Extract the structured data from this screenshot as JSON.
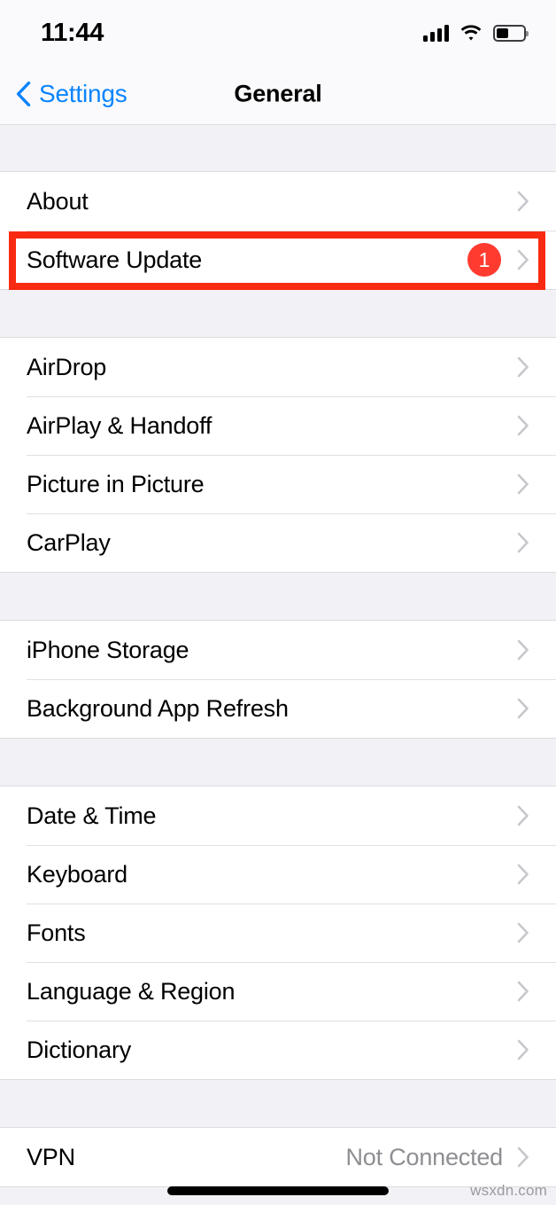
{
  "status_bar": {
    "time": "11:44",
    "cellular_icon": "cellular-signal-icon",
    "wifi_icon": "wifi-icon",
    "battery_icon": "battery-icon",
    "battery_level_percent": 40
  },
  "nav_bar": {
    "back_label": "Settings",
    "back_icon": "chevron-left-icon",
    "title": "General"
  },
  "colors": {
    "accent_blue": "#0A84FF",
    "badge_red": "#FF3B30",
    "highlight_red": "#F92A12",
    "separator": "#E0E0E3",
    "group_background": "#F2F2F6",
    "value_gray": "#8E8E93",
    "chevron_gray": "#C7C7CC"
  },
  "groups": [
    {
      "rows": [
        {
          "label": "About",
          "value": "",
          "badge": "",
          "chevron": "chevron-right-icon"
        },
        {
          "label": "Software Update",
          "value": "",
          "badge": "1",
          "chevron": "chevron-right-icon"
        }
      ]
    },
    {
      "rows": [
        {
          "label": "AirDrop",
          "value": "",
          "badge": "",
          "chevron": "chevron-right-icon"
        },
        {
          "label": "AirPlay & Handoff",
          "value": "",
          "badge": "",
          "chevron": "chevron-right-icon"
        },
        {
          "label": "Picture in Picture",
          "value": "",
          "badge": "",
          "chevron": "chevron-right-icon"
        },
        {
          "label": "CarPlay",
          "value": "",
          "badge": "",
          "chevron": "chevron-right-icon"
        }
      ]
    },
    {
      "rows": [
        {
          "label": "iPhone Storage",
          "value": "",
          "badge": "",
          "chevron": "chevron-right-icon"
        },
        {
          "label": "Background App Refresh",
          "value": "",
          "badge": "",
          "chevron": "chevron-right-icon"
        }
      ]
    },
    {
      "rows": [
        {
          "label": "Date & Time",
          "value": "",
          "badge": "",
          "chevron": "chevron-right-icon"
        },
        {
          "label": "Keyboard",
          "value": "",
          "badge": "",
          "chevron": "chevron-right-icon"
        },
        {
          "label": "Fonts",
          "value": "",
          "badge": "",
          "chevron": "chevron-right-icon"
        },
        {
          "label": "Language & Region",
          "value": "",
          "badge": "",
          "chevron": "chevron-right-icon"
        },
        {
          "label": "Dictionary",
          "value": "",
          "badge": "",
          "chevron": "chevron-right-icon"
        }
      ]
    },
    {
      "rows": [
        {
          "label": "VPN",
          "value": "Not Connected",
          "badge": "",
          "chevron": "chevron-right-icon"
        }
      ]
    }
  ],
  "highlight": {
    "target_row_label": "Software Update"
  },
  "footer": {
    "watermark": "wsxdn.com",
    "home_indicator": "home-indicator"
  }
}
